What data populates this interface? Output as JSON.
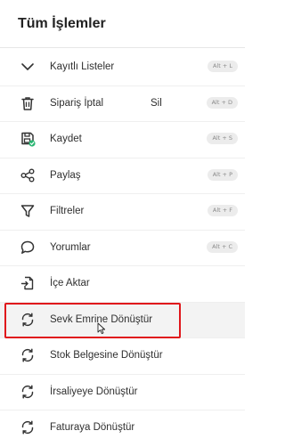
{
  "panel": {
    "title": "Tüm İşlemler"
  },
  "items": [
    {
      "icon": "chevron-down-icon",
      "label": "Kayıtlı Listeler",
      "shortcut": "Alt + L"
    },
    {
      "icon": "trash-icon",
      "label": "Sipariş İptal",
      "extra": "Sil",
      "shortcut": "Alt + D"
    },
    {
      "icon": "save-check-icon",
      "label": "Kaydet",
      "shortcut": "Alt + S"
    },
    {
      "icon": "share-icon",
      "label": "Paylaş",
      "shortcut": "Alt + P"
    },
    {
      "icon": "filter-icon",
      "label": "Filtreler",
      "shortcut": "Alt + F"
    },
    {
      "icon": "comment-icon",
      "label": "Yorumlar",
      "shortcut": "Alt + C"
    },
    {
      "icon": "file-import-icon",
      "label": "İçe Aktar"
    },
    {
      "icon": "convert-icon",
      "label": "Sevk Emrine Dönüştür"
    },
    {
      "icon": "convert-icon",
      "label": "Stok Belgesine Dönüştür"
    },
    {
      "icon": "convert-icon",
      "label": "İrsaliyeye Dönüştür"
    },
    {
      "icon": "convert-icon",
      "label": "Faturaya Dönüştür"
    }
  ],
  "colors": {
    "highlight_box": "#e0161b",
    "save_badge": "#2bb673"
  }
}
